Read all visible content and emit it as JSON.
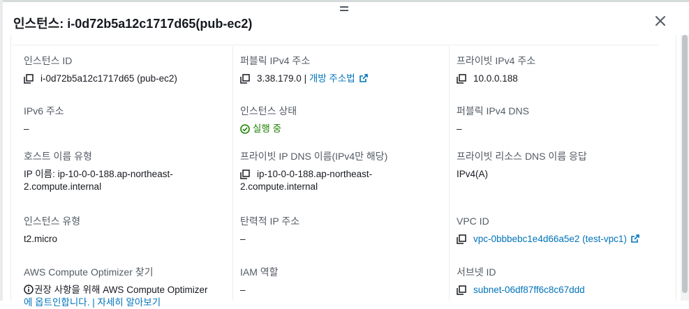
{
  "modal": {
    "title": "인스턴스: i-0d72b5a12c1717d65(pub-ec2)"
  },
  "col1": {
    "instance_id": {
      "label": "인스턴스 ID",
      "value": "i-0d72b5a12c1717d65 (pub-ec2)"
    },
    "ipv6": {
      "label": "IPv6 주소",
      "value": "–"
    },
    "hostname_type": {
      "label": "호스트 이름 유형",
      "line1": "IP 이름: ip-10-0-0-188.ap-northeast-",
      "line2": "2.compute.internal"
    },
    "instance_type": {
      "label": "인스턴스 유형",
      "value": "t2.micro"
    },
    "optimizer": {
      "label": "AWS Compute Optimizer 찾기",
      "line1": "권장 사항을 위해 AWS Compute Optimizer",
      "line2": "에 옵트인합니다. | 자세히 알아보기"
    }
  },
  "col2": {
    "public_ipv4": {
      "label": "퍼블릭 IPv4 주소",
      "value": "3.38.179.0",
      "sep": " | ",
      "link": "개방 주소법"
    },
    "instance_state": {
      "label": "인스턴스 상태",
      "value": "실행 중"
    },
    "private_dns_name": {
      "label": "프라이빗 IP DNS 이름(IPv4만 해당)",
      "line1": "ip-10-0-0-188.ap-northeast-",
      "line2": "2.compute.internal"
    },
    "elastic_ip": {
      "label": "탄력적 IP 주소",
      "value": "–"
    },
    "iam_role": {
      "label": "IAM 역할",
      "value": "–"
    }
  },
  "col3": {
    "private_ipv4": {
      "label": "프라이빗 IPv4 주소",
      "value": "10.0.0.188"
    },
    "public_ipv4_dns": {
      "label": "퍼블릭 IPv4 DNS",
      "value": "–"
    },
    "private_resource_dns": {
      "label": "프라이빗 리소스 DNS 이름 응답",
      "value": "IPv4(A)"
    },
    "vpc_id": {
      "label": "VPC ID",
      "value": "vpc-0bbbebc1e4d66a5e2 (test-vpc1)"
    },
    "subnet_id": {
      "label": "서브넷 ID",
      "value": "subnet-06df87ff6c8c67ddd"
    }
  },
  "colors": {
    "link": "#0073bb",
    "success": "#1d8102",
    "label": "#545b64",
    "text": "#16191f"
  }
}
